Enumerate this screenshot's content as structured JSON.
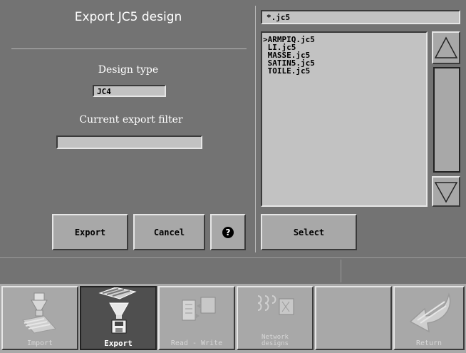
{
  "dialog": {
    "title": "Export JC5 design",
    "design_type_label": "Design type",
    "design_type_value": "JC4",
    "export_filter_label": "Current export filter",
    "export_filter_value": "",
    "export_button": "Export",
    "cancel_button": "Cancel",
    "help_button": "?"
  },
  "file_browser": {
    "filter_value": "*.jc5",
    "files": [
      ">ARMPIQ.jc5",
      " LI.jc5",
      " MASSE.jc5",
      " SATIN5.jc5",
      " TOILE.jc5"
    ],
    "select_button": "Select"
  },
  "status_bar": {
    "left": "",
    "right": ""
  },
  "toolbar": {
    "items": [
      {
        "label": "Import",
        "state": "disabled",
        "icon": "import-icon"
      },
      {
        "label": "Export",
        "state": "active",
        "icon": "export-icon"
      },
      {
        "label": "Read - Write",
        "state": "disabled",
        "icon": "read-write-icon"
      },
      {
        "label": "Network designs",
        "state": "disabled",
        "icon": "network-designs-icon"
      },
      {
        "label": "",
        "state": "empty",
        "icon": ""
      },
      {
        "label": "Return",
        "state": "disabled",
        "icon": "return-icon"
      }
    ]
  }
}
